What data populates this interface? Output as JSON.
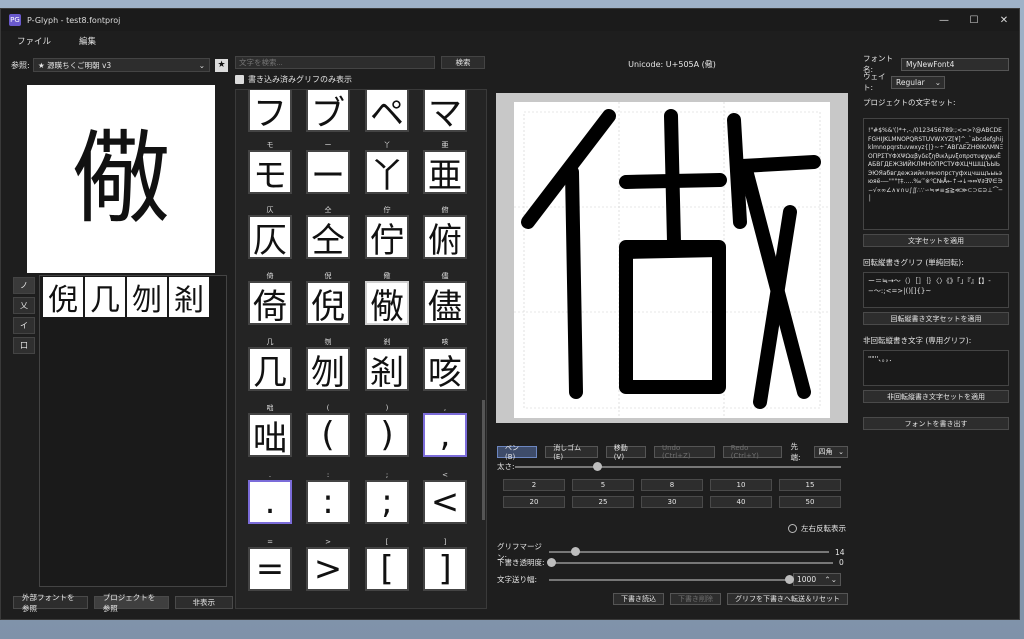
{
  "window": {
    "app_icon": "PG",
    "title": "P-Glyph - test8.fontproj",
    "controls": [
      "—",
      "☐",
      "✕"
    ]
  },
  "menu": [
    "ファイル",
    "編集"
  ],
  "reference": {
    "label": "参照:",
    "font": "★ 源暎ちくご明朝 v3",
    "star": "★",
    "preview_char": "儆",
    "stroke_tabs": [
      "ノ",
      "乂",
      "イ",
      "口"
    ],
    "parts": [
      "倪",
      "几",
      "刎",
      "剎"
    ],
    "buttons": [
      "外部フォントを参照",
      "プロジェクトを参照",
      "非表示"
    ]
  },
  "search": {
    "placeholder": "文字を検索...",
    "button": "検索",
    "filter_label": "書き込み済みグリフのみ表示"
  },
  "glyph_grid": [
    {
      "label": "",
      "glyph": "フ"
    },
    {
      "label": "",
      "glyph": "ブ"
    },
    {
      "label": "",
      "glyph": "ペ"
    },
    {
      "label": "",
      "glyph": "マ"
    },
    {
      "label": "モ",
      "glyph": "モ"
    },
    {
      "label": "ー",
      "glyph": "ー"
    },
    {
      "label": "丫",
      "glyph": "丫"
    },
    {
      "label": "亜",
      "glyph": "亜"
    },
    {
      "label": "仄",
      "glyph": "仄"
    },
    {
      "label": "仝",
      "glyph": "仝"
    },
    {
      "label": "佇",
      "glyph": "佇"
    },
    {
      "label": "俯",
      "glyph": "俯"
    },
    {
      "label": "倚",
      "glyph": "倚"
    },
    {
      "label": "倪",
      "glyph": "倪"
    },
    {
      "label": "儆",
      "glyph": "儆"
    },
    {
      "label": "儘",
      "glyph": "儘"
    },
    {
      "label": "几",
      "glyph": "几"
    },
    {
      "label": "刎",
      "glyph": "刎"
    },
    {
      "label": "剎",
      "glyph": "剎"
    },
    {
      "label": "咳",
      "glyph": "咳"
    },
    {
      "label": "咄",
      "glyph": "咄"
    },
    {
      "label": "(",
      "glyph": "("
    },
    {
      "label": ")",
      "glyph": ")"
    },
    {
      "label": ",",
      "glyph": ","
    },
    {
      "label": ".",
      "glyph": "."
    },
    {
      "label": ":",
      "glyph": ":"
    },
    {
      "label": ";",
      "glyph": ";"
    },
    {
      "label": "<",
      "glyph": "<"
    },
    {
      "label": "=",
      "glyph": "="
    },
    {
      "label": ">",
      "glyph": ">"
    },
    {
      "label": "[",
      "glyph": "["
    },
    {
      "label": "]",
      "glyph": "]"
    }
  ],
  "editor": {
    "unicode": "Unicode: U+505A (儆)",
    "tools": [
      "ペン (B)",
      "消しゴム (E)",
      "移動 (V)",
      "Undo (Ctrl+Z)",
      "Redo (Ctrl+Y)"
    ],
    "tip_label": "先端:",
    "tip_value": "四角",
    "thickness_label": "太さ:",
    "sizes": [
      "2",
      "5",
      "8",
      "10",
      "15",
      "20",
      "25",
      "30",
      "40",
      "50"
    ],
    "mirror_label": "左右反転表示",
    "margin_label": "グリフマージン:",
    "margin_value": "14",
    "opacity_label": "下書き透明度:",
    "opacity_value": "0",
    "advance_label": "文字送り幅:",
    "advance_value": "1000",
    "actions": [
      "下書き読込",
      "下書き削除",
      "グリフを下書きへ転送＆リセット"
    ]
  },
  "font": {
    "name_label": "フォント名:",
    "name_value": "MyNewFont4",
    "weight_label": "ウェイト:",
    "weight_value": "Regular",
    "charset_label": "プロジェクトの文字セット:",
    "charset_text": "!\"#$%&'()*+,-./0123456789:;<=>?@ABCDEFGHIJKLMNOPQRSTUVWXYZ[¥]^_`abcdefghijklmnopqrstuvwxyz{|}~÷˘ΑΒΓΔΕΖΗΘΙΚΛΜΝΞΟΠΡΣΤΥΦΧΨΩαβγδεζηθικλμνξοπρστυφχψωЁАБВГДЕЖЗИЙКЛМНОПРСТУФХЦЧШЩЪЫЬЭЮЯабвгдежзийклмнопрстуфхцчшщъыьэюяё‐―''\"\"†‡‥…‰′″※℃№Å←↑→↓⇒⇔∀∂∃∇∈∋−√∝∞∠∧∨∩∪∫∬∴∵∽≒≠≡≦≧≪≫⊂⊃⊆⊇⊥⌒─│",
    "apply_charset": "文字セットを適用",
    "rotate_label": "回転縦書きグリフ (単純回転):",
    "rotate_text": "ー＝≒→〜（）［］｛｝〈〉《》「」『』【】‐−～:;<=>|()[]{}~",
    "apply_rotate": "回転縦書き文字セットを適用",
    "nonrotate_label": "非回転縦書き文字 (専用グリフ):",
    "nonrotate_text": "\"\"''、。，．",
    "apply_nonrotate": "非回転縦書き文字セットを適用",
    "export": "フォントを書き出す"
  }
}
